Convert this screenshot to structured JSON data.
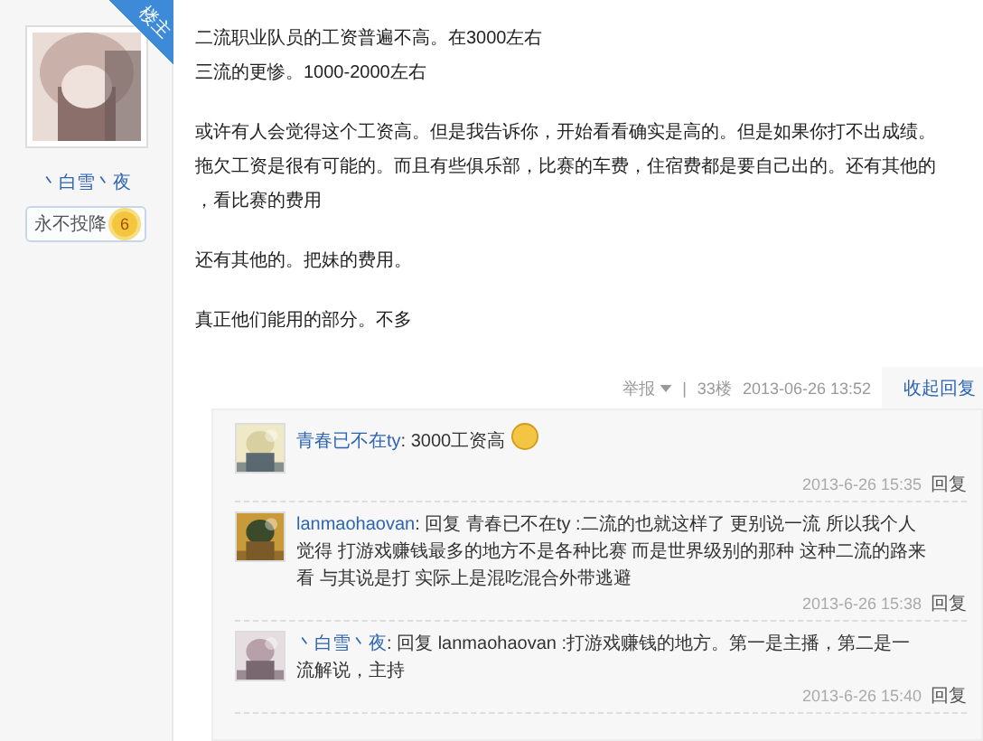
{
  "post": {
    "corner_tag": "楼主",
    "author": {
      "name": "丶白雪丶夜",
      "badge": "永不投降",
      "badge_level": "6"
    },
    "paragraphs": [
      [
        "二流职业队员的工资普遍不高。在3000左右",
        "三流的更惨。1000-2000左右"
      ],
      [
        "或许有人会觉得这个工资高。但是我告诉你，开始看看确实是高的。但是如果你打不出成绩。",
        "拖欠工资是很有可能的。而且有些俱乐部，比赛的车费，住宿费都是要自己出的。还有其他的",
        "，看比赛的费用"
      ],
      [
        "还有其他的。把妹的费用。"
      ],
      [
        "真正他们能用的部分。不多"
      ]
    ],
    "report": "举报",
    "separator": "|",
    "floor": "33楼",
    "time": "2013-06-26 13:52",
    "collapse": "收起回复"
  },
  "replies": [
    {
      "name": "青春已不在ty",
      "text": ": 3000工资高",
      "emoji": true,
      "time": "2013-6-26 15:35",
      "reply": "回复"
    },
    {
      "name": "lanmaohaovan",
      "text": ": 回复 青春已不在ty :二流的也就这样了 更别说一流 所以我个人觉得 打游戏赚钱最多的地方不是各种比赛 而是世界级别的那种 这种二流的路来看 与其说是打 实际上是混吃混合外带逃避",
      "emoji": false,
      "time": "2013-6-26 15:38",
      "reply": "回复"
    },
    {
      "name": "丶白雪丶夜",
      "text": ": 回复 lanmaohaovan :打游戏赚钱的地方。第一是主播，第二是一流解说，主持",
      "emoji": false,
      "time": "2013-6-26 15:40",
      "reply": "回复"
    }
  ]
}
